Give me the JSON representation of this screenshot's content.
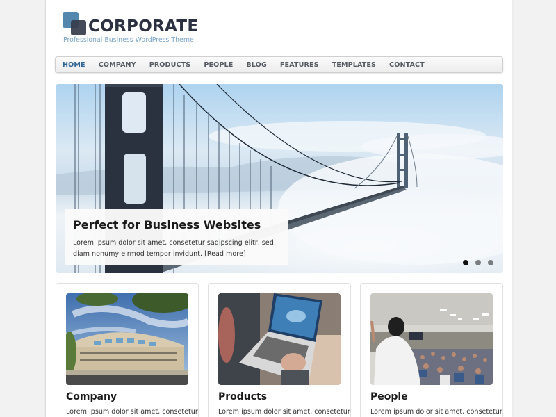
{
  "site": {
    "title": "CORPORATE",
    "tagline": "Professional Business WordPress Theme",
    "colors": {
      "accent": "#2e6593",
      "logo_light": "#5487ad",
      "logo_dark": "#363c4b",
      "tagline": "#7da6c6"
    }
  },
  "nav": {
    "items": [
      {
        "label": "HOME",
        "active": true
      },
      {
        "label": "COMPANY",
        "active": false
      },
      {
        "label": "PRODUCTS",
        "active": false
      },
      {
        "label": "PEOPLE",
        "active": false
      },
      {
        "label": "BLOG",
        "active": false
      },
      {
        "label": "FEATURES",
        "active": false
      },
      {
        "label": "TEMPLATES",
        "active": false
      },
      {
        "label": "CONTACT",
        "active": false
      }
    ]
  },
  "slider": {
    "image": "golden-gate-bridge-in-fog",
    "caption_title": "Perfect for Business Websites",
    "caption_text": "Lorem ipsum dolor sit amet, consetetur sadipscing elitr, sed diam nonumy eirmod tempor invidunt.",
    "read_more": "[Read more]",
    "slide_count": 3,
    "active_slide": 1
  },
  "cards": [
    {
      "title": "Company",
      "text": "Lorem ipsum dolor sit amet, consetetur",
      "image": "office-building"
    },
    {
      "title": "Products",
      "text": "Lorem ipsum dolor sit amet, consetetur",
      "image": "laptop-on-lap"
    },
    {
      "title": "People",
      "text": "Lorem ipsum dolor sit amet, consetetur",
      "image": "presenter-and-audience"
    }
  ]
}
